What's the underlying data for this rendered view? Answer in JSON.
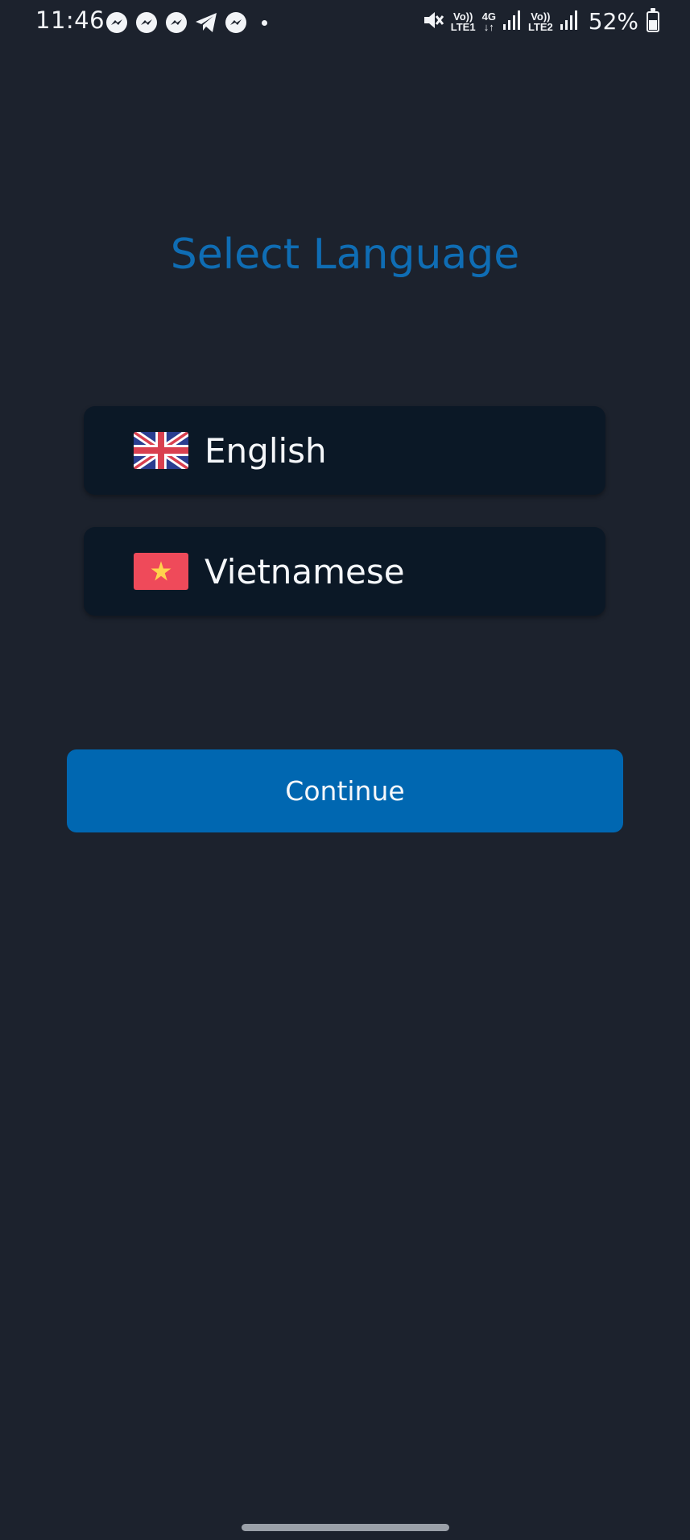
{
  "status_bar": {
    "time": "11:46",
    "left_icons": [
      "messenger-icon",
      "messenger-icon",
      "messenger-icon",
      "telegram-icon",
      "messenger-icon",
      "notification-dot"
    ],
    "network_1_label_top": "Vo))",
    "network_1_label_bottom": "LTE1",
    "network_type_top": "4G",
    "network_type_bottom": "↓↑",
    "network_2_label_top": "Vo))",
    "network_2_label_bottom": "LTE2",
    "battery_percent": "52%",
    "battery_level": 0.52,
    "right_icons": [
      "mute-icon",
      "signal-icon",
      "signal-icon",
      "battery-icon"
    ]
  },
  "page": {
    "title": "Select Language"
  },
  "languages": [
    {
      "label": "English",
      "flag": "uk-flag-icon"
    },
    {
      "label": "Vietnamese",
      "flag": "vietnam-flag-icon"
    }
  ],
  "actions": {
    "continue_label": "Continue"
  },
  "colors": {
    "background": "#1c222d",
    "title": "#0f6db4",
    "option_background": "#0b1826",
    "button": "#0067b1",
    "text": "#f5f7fa"
  }
}
